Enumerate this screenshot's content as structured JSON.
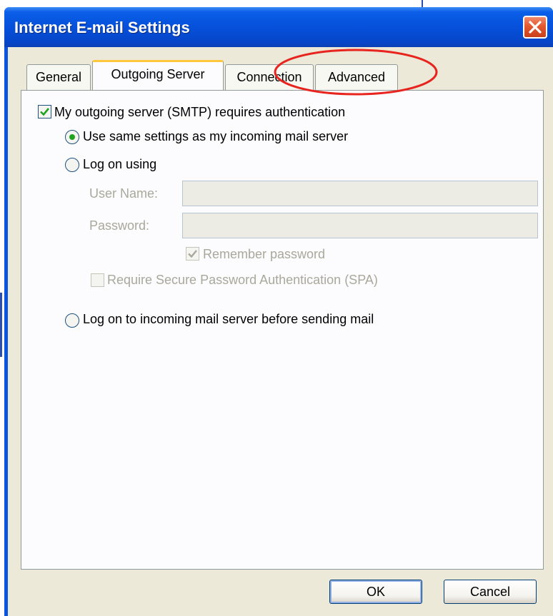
{
  "window": {
    "title": "Internet E-mail Settings"
  },
  "tabs": [
    {
      "label": "General",
      "active": false
    },
    {
      "label": "Outgoing Server",
      "active": true
    },
    {
      "label": "Connection",
      "active": false
    },
    {
      "label": "Advanced",
      "active": false
    }
  ],
  "outgoing": {
    "smtp_auth_label": "My outgoing server (SMTP) requires authentication",
    "smtp_auth_checked": true,
    "use_same_label": "Use same settings as my incoming mail server",
    "use_same_selected": true,
    "log_on_using_label": "Log on using",
    "log_on_using_selected": false,
    "username_label": "User Name:",
    "username_value": "",
    "password_label": "Password:",
    "password_value": "",
    "remember_password_label": "Remember password",
    "remember_password_checked": true,
    "spa_label": "Require Secure Password Authentication (SPA)",
    "spa_checked": false,
    "log_on_incoming_label": "Log on to incoming mail server before sending mail",
    "log_on_incoming_selected": false
  },
  "buttons": {
    "ok": "OK",
    "cancel": "Cancel"
  },
  "icons": {
    "close": "close-icon",
    "check": "check-icon"
  },
  "colors": {
    "titlebar": "#0650da",
    "close_button": "#e3582f",
    "dialog_face": "#ece9d8",
    "active_tab_accent": "#ffc83c",
    "radio_selected": "#21a121",
    "annotation": "#e8241f"
  }
}
